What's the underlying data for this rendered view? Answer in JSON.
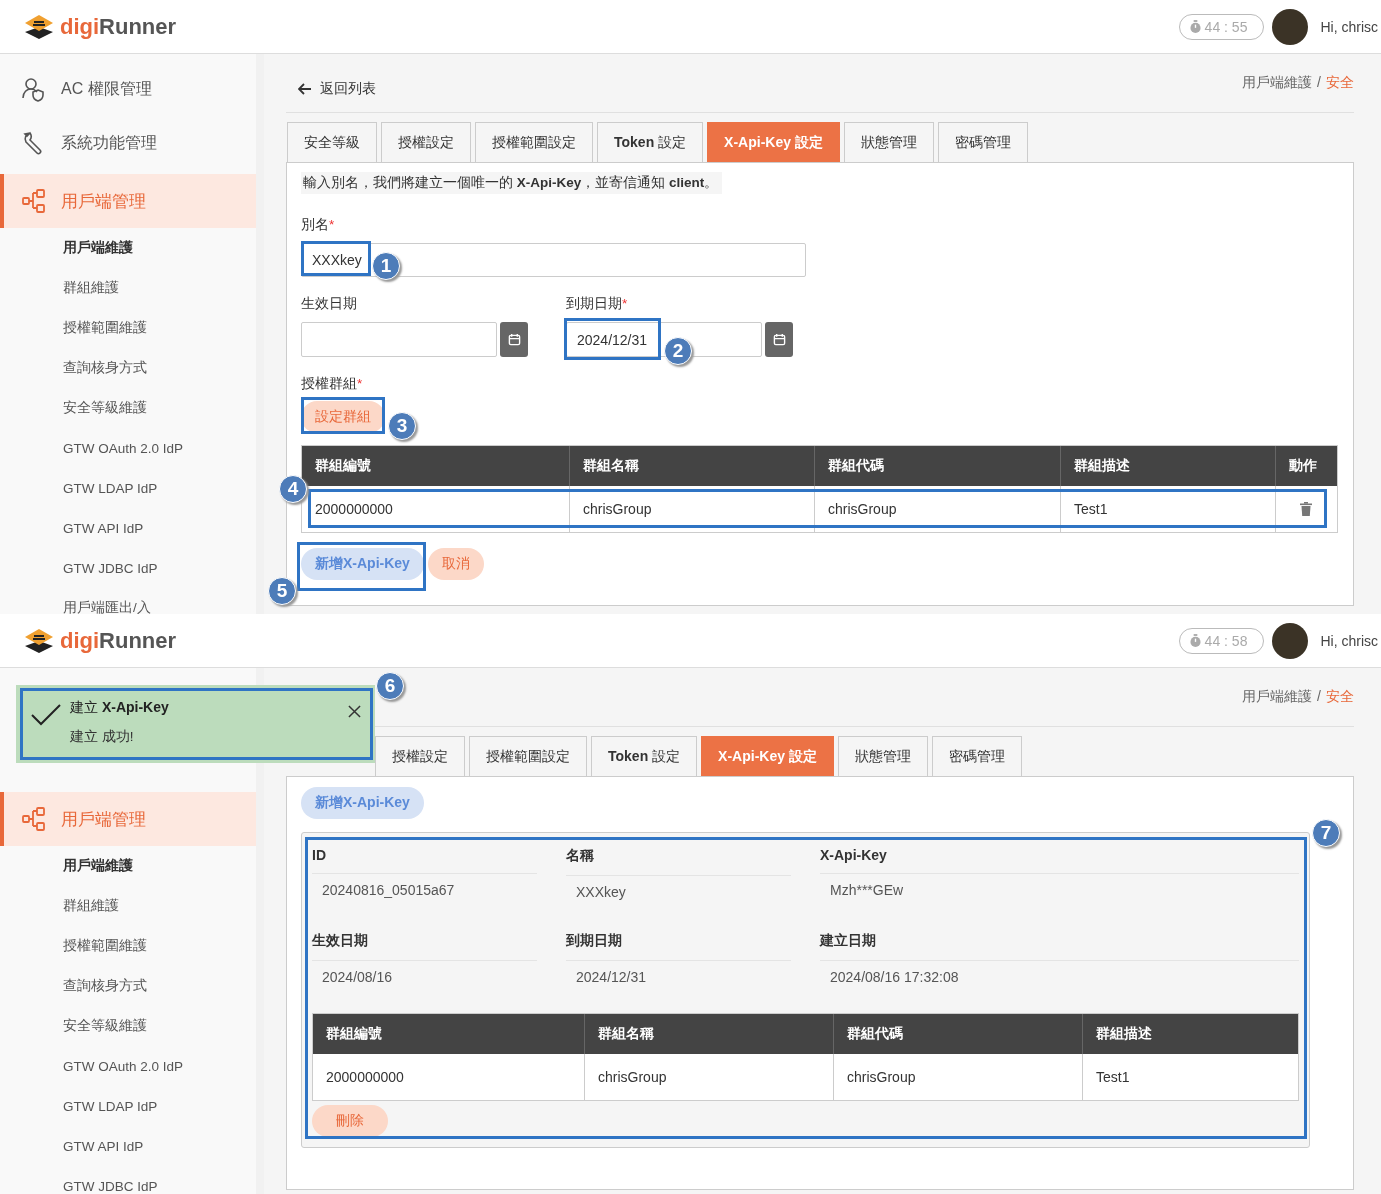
{
  "screens": [
    {
      "header": {
        "logo_accent": "digi",
        "logo_rest": "Runner",
        "timer": "44 : 55",
        "greeting": "Hi, chrisc"
      },
      "sidebar": {
        "items": [
          {
            "label": "AC 權限管理",
            "kind": "people",
            "selected": false
          },
          {
            "label": "系統功能管理",
            "kind": "wrench",
            "selected": false
          },
          {
            "label": "用戶端管理",
            "kind": "nodes",
            "selected": true,
            "children": [
              {
                "label": "用戶端維護",
                "selected": true
              },
              {
                "label": "群組維護",
                "selected": false
              },
              {
                "label": "授權範圍維護",
                "selected": false
              },
              {
                "label": "查詢核身方式",
                "selected": false
              },
              {
                "label": "安全等級維護",
                "selected": false
              },
              {
                "label": "GTW OAuth 2.0 IdP",
                "selected": false
              },
              {
                "label": "GTW LDAP IdP",
                "selected": false
              },
              {
                "label": "GTW API IdP",
                "selected": false
              },
              {
                "label": "GTW JDBC IdP",
                "selected": false
              },
              {
                "label": "用戶端匯出/入",
                "selected": false
              }
            ]
          }
        ]
      },
      "main": {
        "back_link": "返回列表",
        "breadcrumb": [
          "用戶端維護",
          "安全"
        ],
        "breadcrumb_separator": "/",
        "tabs": [
          {
            "label": "安全等級",
            "selected": false
          },
          {
            "label": "授權設定",
            "selected": false
          },
          {
            "label": "授權範圍設定",
            "selected": false
          },
          {
            "label": "**Token** 設定",
            "selected": false
          },
          {
            "label": "**X-Api-Key** 設定",
            "selected": true
          },
          {
            "label": "狀態管理",
            "selected": false
          },
          {
            "label": "密碼管理",
            "selected": false
          }
        ],
        "kind": "form",
        "form": {
          "note": "輸入別名，我們將建立一個唯一的 **X-Api-Key**，並寄信通知 **client**。",
          "alias": {
            "label": "別名",
            "required_mark": "*",
            "value": "XXXkey"
          },
          "start_date": {
            "label": "生效日期"
          },
          "end_date": {
            "label": "到期日期",
            "required_mark": "*",
            "value": "2024/12/31"
          },
          "group": {
            "label": "授權群組",
            "required_mark": "*",
            "button": "設定群組"
          },
          "table": {
            "columns": [
              "群組編號",
              "群組名稱",
              "群組代碼",
              "群組描述",
              "動作"
            ],
            "rows": [
              {
                "cells": [
                  "2000000000",
                  "chrisGroup",
                  "chrisGroup",
                  "Test1"
                ]
              }
            ]
          },
          "buttons": [
            {
              "label": "新增X-Api-Key",
              "kind": "primary"
            },
            {
              "label": "取消",
              "kind": "secondary"
            }
          ]
        }
      },
      "annotations": [
        "1",
        "2",
        "3",
        "4",
        "5"
      ]
    },
    {
      "header": {
        "logo_accent": "digi",
        "logo_rest": "Runner",
        "timer": "44 : 58",
        "greeting": "Hi, chrisc"
      },
      "sidebar": {
        "items": [
          {
            "label": "用戶端管理",
            "kind": "nodes",
            "selected": true,
            "children": [
              {
                "label": "用戶端維護",
                "selected": true
              },
              {
                "label": "群組維護",
                "selected": false
              },
              {
                "label": "授權範圍維護",
                "selected": false
              },
              {
                "label": "查詢核身方式",
                "selected": false
              },
              {
                "label": "安全等級維護",
                "selected": false
              },
              {
                "label": "GTW OAuth 2.0 IdP",
                "selected": false
              },
              {
                "label": "GTW LDAP IdP",
                "selected": false
              },
              {
                "label": "GTW API IdP",
                "selected": false
              },
              {
                "label": "GTW JDBC IdP",
                "selected": false
              }
            ]
          }
        ]
      },
      "toast": {
        "title": "建立 **X-Api-Key**",
        "message": "建立 成功!"
      },
      "main": {
        "breadcrumb": [
          "用戶端維護",
          "安全"
        ],
        "breadcrumb_separator": "/",
        "tabs": [
          {
            "label": "授權設定",
            "selected": false
          },
          {
            "label": "授權範圍設定",
            "selected": false
          },
          {
            "label": "**Token** 設定",
            "selected": false
          },
          {
            "label": "**X-Api-Key** 設定",
            "selected": true
          },
          {
            "label": "狀態管理",
            "selected": false
          },
          {
            "label": "密碼管理",
            "selected": false
          }
        ],
        "kind": "detail",
        "detail": {
          "add_button": "新增X-Api-Key",
          "fields": [
            {
              "label": "ID",
              "value": "20240816_05015a67"
            },
            {
              "label": "名稱",
              "value": "XXXkey"
            },
            {
              "label": "X-Api-Key",
              "value": "Mzh***GEw"
            },
            {
              "label": "生效日期",
              "value": "2024/08/16"
            },
            {
              "label": "到期日期",
              "value": "2024/12/31"
            },
            {
              "label": "建立日期",
              "value": "2024/08/16 17:32:08"
            }
          ],
          "table": {
            "columns": [
              "群組編號",
              "群組名稱",
              "群組代碼",
              "群組描述"
            ],
            "rows": [
              {
                "cells": [
                  "2000000000",
                  "chrisGroup",
                  "chrisGroup",
                  "Test1"
                ]
              }
            ]
          },
          "delete_button": "刪除"
        }
      },
      "annotations": [
        "6",
        "7"
      ]
    }
  ]
}
